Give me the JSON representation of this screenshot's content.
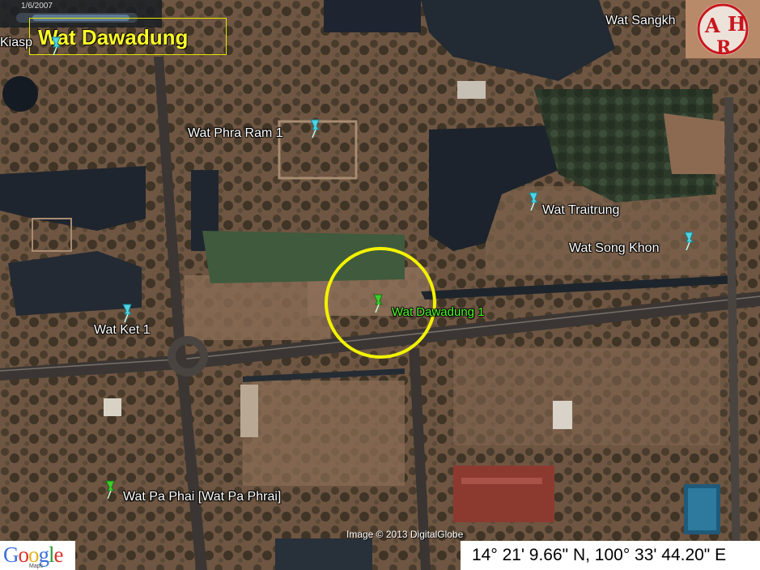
{
  "title": "Wat Dawadung",
  "coordinates": "14° 21' 9.66\" N, 100° 33' 44.20\" E",
  "image_credit": "Image © 2013 DigitalGlobe",
  "history_date": "1/6/2007",
  "google_logo": {
    "text": "Google",
    "sub": "Maps"
  },
  "corner_logo": {
    "letters": "ARH",
    "icon": "arh-seal-icon"
  },
  "places": [
    {
      "name": "Wat Phra Ram 1",
      "icon": "pushpin-cyan-icon"
    },
    {
      "name": "Wat Traitrung",
      "icon": "pushpin-cyan-icon"
    },
    {
      "name": "Wat Song Khon",
      "icon": "pushpin-cyan-icon"
    },
    {
      "name": "Wat Dawadung 1",
      "icon": "pushpin-green-icon"
    },
    {
      "name": "Wat Ket 1",
      "icon": "pushpin-cyan-icon"
    },
    {
      "name": "Wat Pa Phai [Wat Pa Phrai]",
      "icon": "pushpin-green-icon"
    },
    {
      "name": "Wat Sangkh",
      "icon": "none"
    },
    {
      "name": "Kiasp",
      "icon": "pushpin-cyan-icon"
    }
  ],
  "colors": {
    "title": "#ffff2a",
    "highlight_circle": "#f2f200",
    "highlight_label": "#4cff2a",
    "cyan_pin": "#4dd6e6",
    "green_pin": "#3bcf2c"
  }
}
